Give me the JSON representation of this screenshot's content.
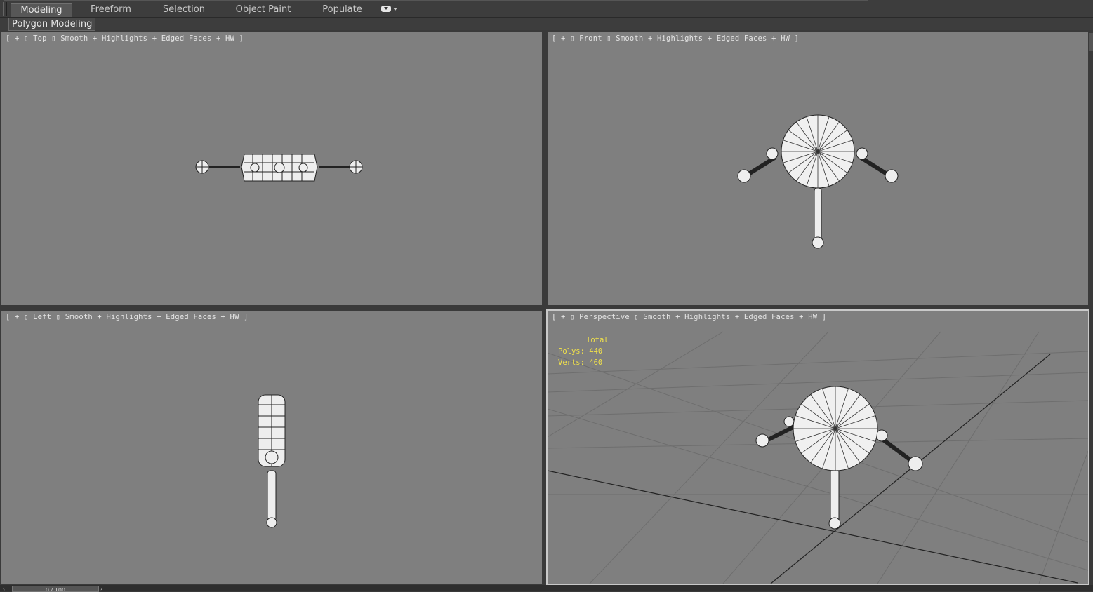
{
  "ribbon": {
    "tabs": [
      "Modeling",
      "Freeform",
      "Selection",
      "Object Paint",
      "Populate"
    ],
    "active_tab": "Modeling",
    "menu_icon": "ribbon-menu-icon",
    "sub_tab": "Polygon Modeling"
  },
  "viewports": {
    "top": {
      "label": "[ + ▯ Top ▯ Smooth + Highlights + Edged Faces + HW ]"
    },
    "front": {
      "label": "[ + ▯ Front ▯ Smooth + Highlights + Edged Faces + HW ]"
    },
    "left": {
      "label": "[ + ▯ Left ▯ Smooth + Highlights + Edged Faces + HW ]"
    },
    "perspective": {
      "label": "[ + ▯ Perspective ▯ Smooth + Highlights + Edged Faces + HW ]",
      "stats": {
        "title": "Total",
        "polys": "Polys: 440",
        "verts": "Verts: 460"
      }
    }
  },
  "timeline": {
    "frame": "0 / 100"
  },
  "colors": {
    "viewport_bg": "#7f7f7f",
    "ui_bg": "#3d3d3d",
    "stats_text": "#f2e24a",
    "active_border": "#c9c9c9"
  }
}
